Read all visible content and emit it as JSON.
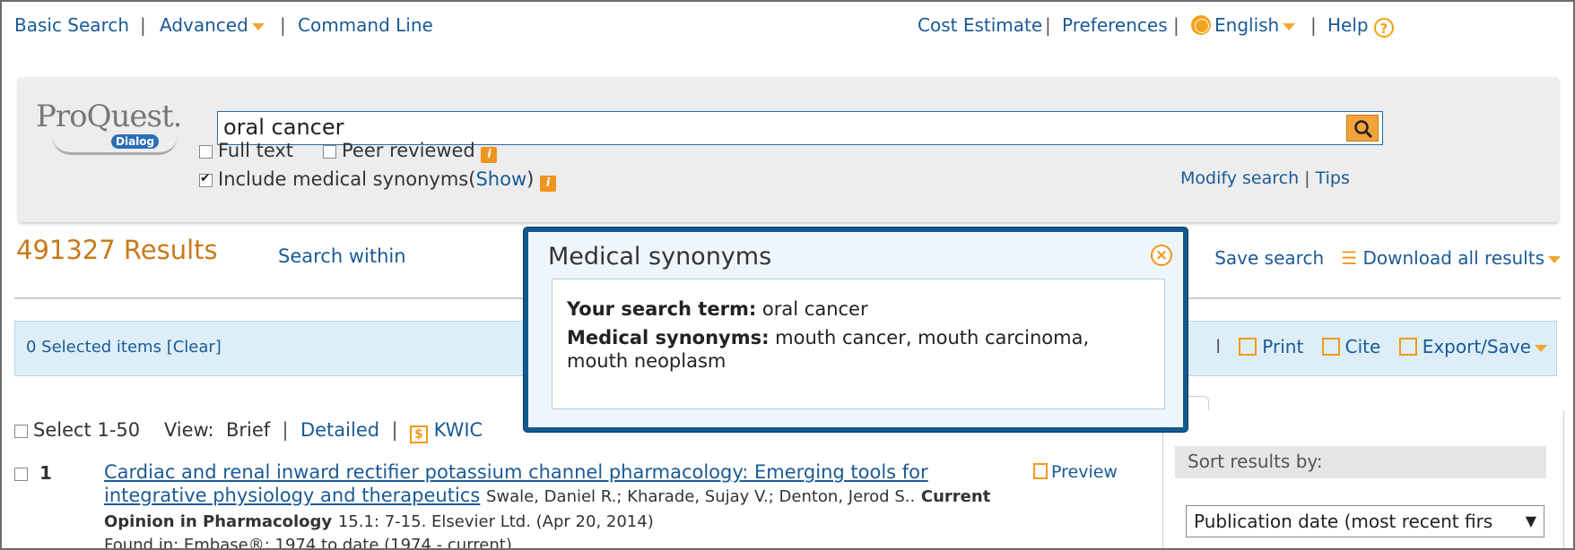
{
  "nav": {
    "basic_search": "Basic Search",
    "advanced": "Advanced",
    "command_line": "Command Line",
    "cost_estimate": "Cost Estimate",
    "preferences": "Preferences",
    "language": "English",
    "help": "Help"
  },
  "search": {
    "logo_text": "ProQuest.",
    "logo_sub": "Dialog",
    "query": "oral cancer",
    "full_text": "Full text",
    "peer_reviewed": "Peer reviewed",
    "medical_synonyms": "Include medical synonyms",
    "show": "Show",
    "modify_search": "Modify search",
    "tips": "Tips"
  },
  "results": {
    "count": "491327 Results",
    "search_within": "Search within",
    "save_search": "Save search",
    "download_all": "Download all results",
    "selected": "0 Selected items [Clear]",
    "print": "Print",
    "cite": "Cite",
    "export_save": "Export/Save",
    "select_range": "Select 1-50",
    "view_label": "View:",
    "view_brief": "Brief",
    "view_detailed": "Detailed",
    "view_kwic": "KWIC",
    "items": [
      {
        "number": "1",
        "title": "Cardiac and renal inward rectifier potassium channel pharmacology: Emerging tools for integrative physiology and therapeutics",
        "authors": "Swale, Daniel R.; Kharade, Sujay V.; Denton, Jerod S..",
        "journal": "Current Opinion in Pharmacology",
        "citation": "15.1: 7-15. Elsevier Ltd. (Apr 20, 2014)",
        "found_in": "Found in:      Embase®: 1974 to date (1974 - current)",
        "preview": "Preview"
      }
    ]
  },
  "sidebar": {
    "sort_label": "Sort results by:",
    "sort_value": "Publication date (most recent firs"
  },
  "popup": {
    "title": "Medical synonyms",
    "term_label": "Your search term:",
    "term_value": "oral cancer",
    "syn_label": "Medical synonyms:",
    "syn_value": "mouth cancer, mouth carcinoma, mouth neoplasm"
  },
  "colors": {
    "link": "#1a5a96",
    "accent_orange": "#f0941d",
    "result_count": "#c87a1b",
    "popup_border": "#12598e"
  }
}
